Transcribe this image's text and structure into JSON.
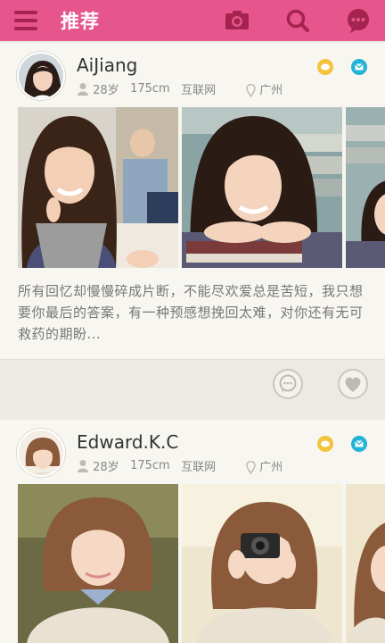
{
  "topbar": {
    "title": "推荐",
    "menu_icon": "menu-icon",
    "camera_icon": "camera-icon",
    "search_icon": "search-icon",
    "chat_icon": "chat-icon",
    "bg_color": "#e6558b"
  },
  "feed": [
    {
      "name": "AiJiang",
      "age": "28岁",
      "height": "175cm",
      "industry": "互联网",
      "location": "广州",
      "description": "所有回忆却慢慢碎成片断，不能尽欢爱总是苦短，我只想要你最后的答案，有一种预感想挽回太难，对你还有无可救药的期盼..."
    },
    {
      "name": "Edward.K.C",
      "age": "28岁",
      "height": "175cm",
      "industry": "互联网",
      "location": "广州"
    }
  ],
  "colors": {
    "accent": "#e6558b",
    "vip_badge": "#f3c33c",
    "mail_badge": "#22b3d6"
  }
}
